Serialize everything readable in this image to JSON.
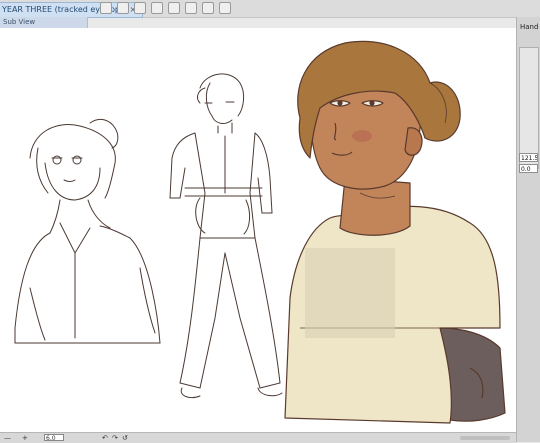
{
  "document": {
    "tab_title": "YEAR THREE (tracked eyyppp)",
    "close_glyph": "×"
  },
  "subview": {
    "label": "Sub View"
  },
  "right_panel": {
    "tool_label": "Hand",
    "field1": "121.5",
    "field2": "0.0"
  },
  "status": {
    "minus": "—",
    "plus": "+",
    "zoom_value": "6.0",
    "rotate_left": "↶",
    "rotate_right": "↷",
    "reset": "↺"
  },
  "colors": {
    "skin": "#c2855a",
    "hair": "#a9773e",
    "shirt": "#efe6c8",
    "line": "#5a3a2d",
    "sleeve": "#6b5e5c"
  }
}
